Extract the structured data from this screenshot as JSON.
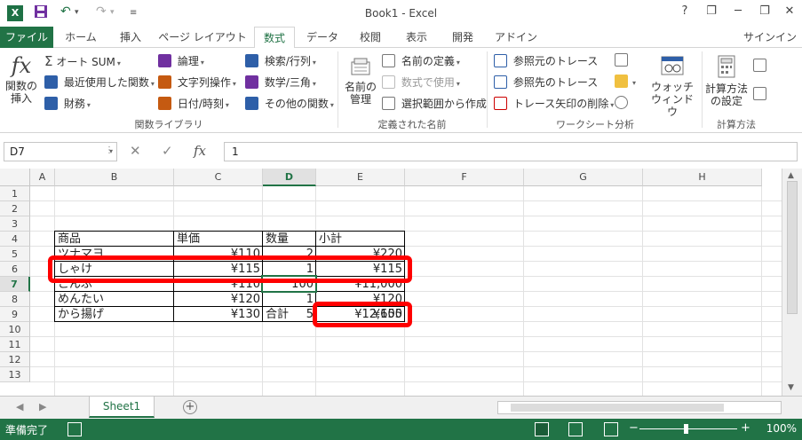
{
  "window": {
    "title": "Book1 - Excel",
    "app_icon": "X",
    "help": "?",
    "minimize": "─",
    "restore": "❐",
    "close": "✕",
    "qa_save_icon": "save-icon",
    "qa_undo_icon": "undo-icon",
    "qa_redo_icon": "redo-icon"
  },
  "tabs": {
    "file": "ファイル",
    "home": "ホーム",
    "insert": "挿入",
    "page_layout": "ページ レイアウト",
    "formulas": "数式",
    "data": "データ",
    "review": "校閲",
    "view": "表示",
    "developer": "開発",
    "addins": "アドイン",
    "signin": "サインイン"
  },
  "ribbon": {
    "insert_function": "関数の\n挿入",
    "autosum": "オート SUM",
    "recent": "最近使用した関数",
    "financial": "財務",
    "logical": "論理",
    "text": "文字列操作",
    "datetime": "日付/時刻",
    "lookup": "検索/行列",
    "math": "数学/三角",
    "more": "その他の関数",
    "group_library": "関数ライブラリ",
    "name_manager": "名前の\n管理",
    "define_name": "名前の定義",
    "use_in_formula": "数式で使用",
    "create_from_selection": "選択範囲から作成",
    "group_names": "定義された名前",
    "trace_precedents": "参照元のトレース",
    "trace_dependents": "参照先のトレース",
    "remove_arrows": "トレース矢印の削除",
    "watch_window": "ウォッチ\nウィンドウ",
    "group_audit": "ワークシート分析",
    "calc_options": "計算方法\nの設定",
    "group_calc": "計算方法"
  },
  "formula_bar": {
    "name_box": "D7",
    "value": "1",
    "cancel": "✕",
    "enter": "✓",
    "fx": "fx"
  },
  "grid": {
    "columns": [
      "A",
      "B",
      "C",
      "D",
      "E",
      "F",
      "G",
      "H"
    ],
    "rows": [
      "1",
      "2",
      "3",
      "4",
      "5",
      "6",
      "7",
      "8",
      "9",
      "10",
      "11",
      "12",
      "13"
    ],
    "selected_column": "D",
    "selected_row": "7",
    "table": {
      "headers": [
        "商品",
        "単価",
        "数量",
        "小計"
      ],
      "rows": [
        [
          "ツナマヨ",
          "¥110",
          "2",
          "¥220"
        ],
        [
          "しゃけ",
          "¥115",
          "1",
          "¥115"
        ],
        [
          "こんぶ",
          "¥110",
          "100",
          "¥11,000"
        ],
        [
          "めんたい",
          "¥120",
          "1",
          "¥120"
        ],
        [
          "から揚げ",
          "¥130",
          "5",
          "¥650"
        ]
      ],
      "total_label": "合計",
      "total_value": "¥12,105"
    },
    "highlight_color": "#ff0000"
  },
  "sheets": {
    "active": "Sheet1",
    "add": "+"
  },
  "status": {
    "ready": "準備完了",
    "zoom": "100%",
    "zoom_minus": "−",
    "zoom_plus": "+"
  },
  "colors": {
    "accent": "#217346"
  }
}
